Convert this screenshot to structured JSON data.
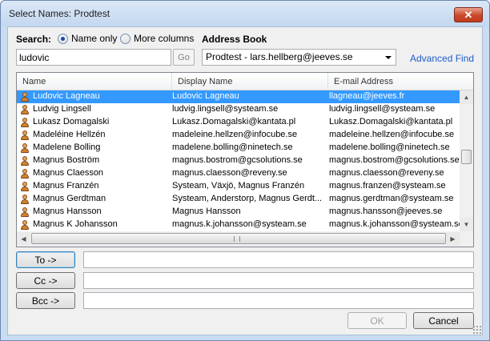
{
  "window": {
    "title": "Select Names: Prodtest",
    "close_glyph": "✕"
  },
  "search": {
    "label": "Search:",
    "options": [
      {
        "label": "Name only",
        "selected": true
      },
      {
        "label": "More columns",
        "selected": false
      }
    ],
    "value": "ludovic",
    "go_label": "Go"
  },
  "address_book": {
    "label": "Address Book",
    "selected": "Prodtest - lars.hellberg@jeeves.se",
    "advanced_find": "Advanced Find"
  },
  "list": {
    "columns": [
      "Name",
      "Display Name",
      "E-mail Address"
    ],
    "rows": [
      {
        "name": "Ludovic Lagneau",
        "display": "Ludovic Lagneau",
        "email": "llagneau@jeeves.fr",
        "selected": true
      },
      {
        "name": "Ludvig Lingsell",
        "display": "ludvig.lingsell@systeam.se",
        "email": "ludvig.lingsell@systeam.se",
        "selected": false
      },
      {
        "name": "Lukasz Domagalski",
        "display": "Lukasz.Domagalski@kantata.pl",
        "email": "Lukasz.Domagalski@kantata.pl",
        "selected": false
      },
      {
        "name": "Madeléine Hellzén",
        "display": "madeleine.hellzen@infocube.se",
        "email": "madeleine.hellzen@infocube.se",
        "selected": false
      },
      {
        "name": "Madelene Bolling",
        "display": "madelene.bolling@ninetech.se",
        "email": "madelene.bolling@ninetech.se",
        "selected": false
      },
      {
        "name": "Magnus Boström",
        "display": "magnus.bostrom@gcsolutions.se",
        "email": "magnus.bostrom@gcsolutions.se",
        "selected": false
      },
      {
        "name": "Magnus Claesson",
        "display": "magnus.claesson@reveny.se",
        "email": "magnus.claesson@reveny.se",
        "selected": false
      },
      {
        "name": "Magnus Franzén",
        "display": "Systeam, Växjö, Magnus Franzén",
        "email": "magnus.franzen@systeam.se",
        "selected": false
      },
      {
        "name": "Magnus Gerdtman",
        "display": "Systeam, Anderstorp, Magnus Gerdt...",
        "email": "magnus.gerdtman@systeam.se",
        "selected": false
      },
      {
        "name": "Magnus Hansson",
        "display": "Magnus Hansson",
        "email": "magnus.hansson@jeeves.se",
        "selected": false
      },
      {
        "name": "Magnus K Johansson",
        "display": "magnus.k.johansson@systeam.se",
        "email": "magnus.k.johansson@systeam.se",
        "selected": false
      }
    ]
  },
  "recipients": {
    "to_label": "To ->",
    "cc_label": "Cc ->",
    "bcc_label": "Bcc ->"
  },
  "buttons": {
    "ok": "OK",
    "cancel": "Cancel"
  },
  "colors": {
    "selection": "#3399ff",
    "link": "#1c5ec9",
    "close": "#c9472a"
  }
}
